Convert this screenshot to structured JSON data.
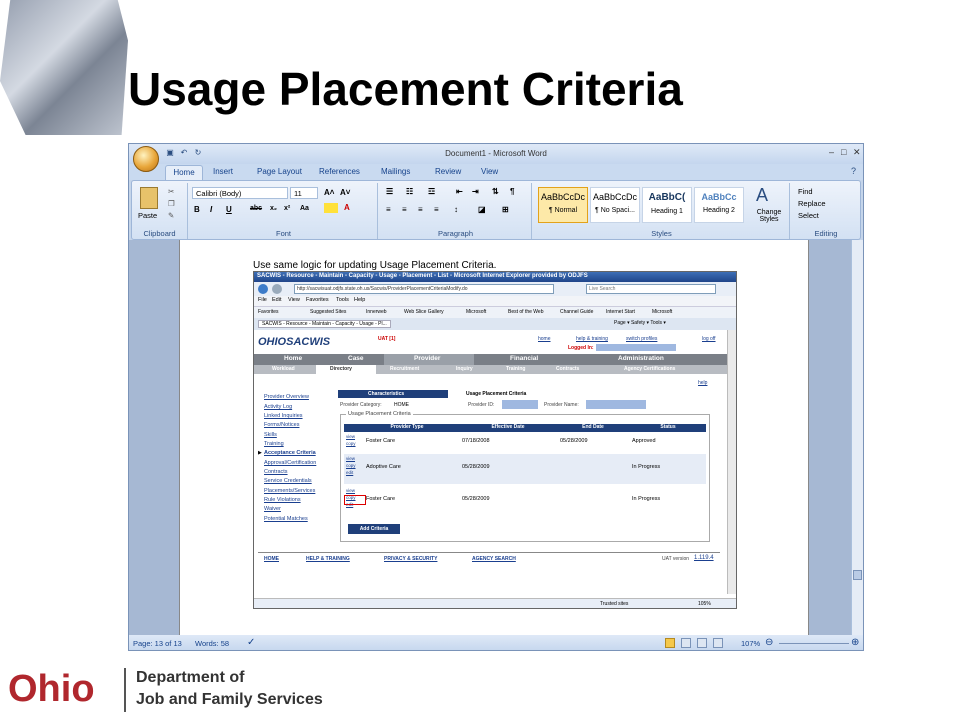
{
  "slide_title": "Usage Placement Criteria",
  "word": {
    "window_title": "Document1 - Microsoft Word",
    "tabs": [
      "Home",
      "Insert",
      "Page Layout",
      "References",
      "Mailings",
      "Review",
      "View"
    ],
    "font_name": "Calibri (Body)",
    "font_size": "11",
    "styles": [
      {
        "sample": "AaBbCcDc",
        "name": "¶ Normal"
      },
      {
        "sample": "AaBbCcDc",
        "name": "¶ No Spaci..."
      },
      {
        "sample": "AaBbC(",
        "name": "Heading 1"
      },
      {
        "sample": "AaBbCc",
        "name": "Heading 2"
      }
    ],
    "change_styles": "Change Styles",
    "editing": [
      "Find",
      "Replace",
      "Select"
    ],
    "groups": [
      "Clipboard",
      "Font",
      "Paragraph",
      "Styles",
      "Editing"
    ],
    "paste": "Paste",
    "status_page": "Page: 13 of 13",
    "status_words": "Words: 58",
    "zoom": "107%",
    "doc_text": "Use same logic for updating Usage Placement Criteria."
  },
  "ie": {
    "title": "SACWIS - Resource - Maintain - Capacity - Usage - Placement - List - Microsoft Internet Explorer provided by ODJFS",
    "url": "http://sacwisuat.odjfs.state.oh.us/Sacwis/ProviderPlacementCriteriaModify.do",
    "live_search": "Live Search",
    "menu": [
      "File",
      "Edit",
      "View",
      "Favorites",
      "Tools",
      "Help"
    ],
    "favorites": [
      "Favorites",
      "Suggested Sites",
      "Innerweb",
      "Web Slice Gallery",
      "Microsoft",
      "Best of the Web",
      "Channel Guide",
      "Internet Start",
      "Microsoft"
    ],
    "tab_title": "SACWIS - Resource - Maintain - Capacity - Usage - Pl...",
    "toolbar_right": "Page ▾  Safety ▾  Tools ▾",
    "status_trusted": "Trusted sites",
    "status_zoom": "105%"
  },
  "sacwis": {
    "logo": "OHIOSACWIS",
    "env": "UAT [1]",
    "logged_in": "Logged In:",
    "toplinks": [
      "home",
      "help & training",
      "switch profiles",
      "log off"
    ],
    "main_nav": [
      "Home",
      "Case",
      "Provider",
      "Financial",
      "Administration"
    ],
    "sub_nav": [
      "Workload",
      "Directory",
      "Recruitment",
      "Inquiry",
      "Training",
      "Contracts",
      "Agency Certifications"
    ],
    "help": "help",
    "side_links": [
      "Provider Overview",
      "Activity Log",
      "Linked Inquiries",
      "Forms/Notices",
      "Skills",
      "Training",
      "Acceptance Criteria",
      "Approval/Certification",
      "Contracts",
      "Service Credentials",
      "Placements/Services",
      "Rule Violations",
      "Waiver",
      "Potential Matches"
    ],
    "content_tabs": [
      "Characteristics",
      "Usage Placement Criteria"
    ],
    "provider_category_label": "Provider Category:",
    "provider_category": "HOME",
    "provider_id_label": "Provider ID:",
    "provider_name_label": "Provider Name:",
    "fieldset": "Usage Placement Criteria",
    "columns": [
      "Provider Type",
      "Effective Date",
      "End Date",
      "Status"
    ],
    "rows": [
      {
        "links": [
          "view",
          "copy"
        ],
        "type": "Foster Care",
        "eff": "07/18/2008",
        "end": "05/28/2009",
        "status": "Approved"
      },
      {
        "links": [
          "view",
          "copy",
          "edit"
        ],
        "type": "Adoptive Care",
        "eff": "05/28/2009",
        "end": "",
        "status": "In Progress"
      },
      {
        "links": [
          "view",
          "copy",
          "edit"
        ],
        "type": "Foster Care",
        "eff": "05/28/2009",
        "end": "",
        "status": "In Progress"
      }
    ],
    "add_button": "Add Criteria",
    "footer_links": [
      "HOME",
      "HELP & TRAINING",
      "PRIVACY & SECURITY",
      "AGENCY SEARCH"
    ],
    "uat_version_label": "UAT version",
    "uat_version": "1.119.4"
  },
  "footer": {
    "ohio": "Ohio",
    "dept_line1": "Department of",
    "dept_line2": "Job and Family Services"
  },
  "colors": {
    "ohio_red": "#b0272d",
    "sacwis_nav": "#7a7f87",
    "header_blue": "#1f3f7a"
  }
}
